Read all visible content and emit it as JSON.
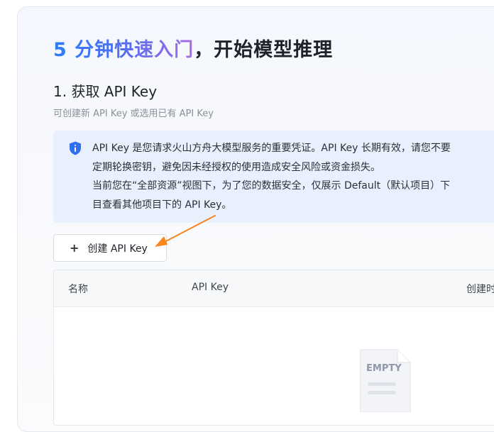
{
  "hero": {
    "highlight": "5 分钟快速入门",
    "rest": "，开始模型推理"
  },
  "step": {
    "title": "1. 获取 API Key",
    "subtitle": "可创建新 API Key 或选用已有 API Key"
  },
  "alert": {
    "icon": "shield-info-icon",
    "lines": [
      "API Key 是您请求火山方舟大模型服务的重要凭证。API Key 长期有效，请您不要",
      "定期轮换密钥，避免因未经授权的使用造成安全风险或资金损失。",
      "当前您在“全部资源”视图下，为了您的数据安全，仅展示 Default（默认项目）下",
      "目查看其他项目下的 API Key。"
    ]
  },
  "create_button": {
    "icon": "plus-icon",
    "label": "创建 API Key"
  },
  "table": {
    "columns": [
      "名称",
      "API Key",
      "创建时"
    ],
    "empty_label": "EMPTY"
  },
  "colors": {
    "accent_start": "#2f7cf7",
    "accent_end": "#a66be8",
    "alert_bg": "#e8effd",
    "info_icon": "#2f6ff0",
    "annotation_arrow": "#f7861f"
  }
}
